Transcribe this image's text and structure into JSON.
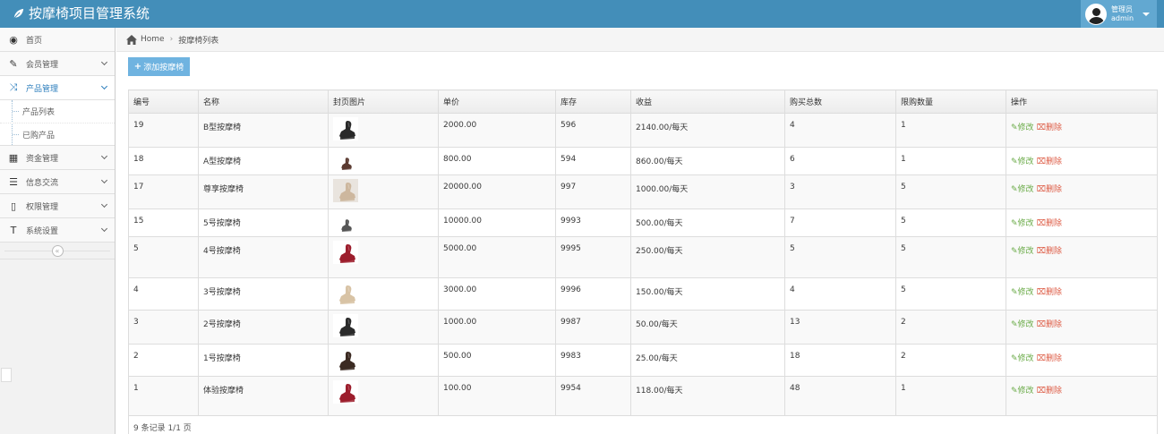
{
  "app": {
    "title": "按摩椅项目管理系统"
  },
  "user": {
    "role": "管理员",
    "name": "admin"
  },
  "sidebar": {
    "items": [
      {
        "label": "首页",
        "icon": "dashboard-icon",
        "glyph": "◉"
      },
      {
        "label": "会员管理",
        "icon": "edit-icon",
        "glyph": "✎"
      },
      {
        "label": "产品管理",
        "icon": "shuffle-icon",
        "glyph": "⤨",
        "open": true,
        "children": [
          {
            "label": "产品列表"
          },
          {
            "label": "已购产品"
          }
        ]
      },
      {
        "label": "资金管理",
        "icon": "calendar-icon",
        "glyph": "▦"
      },
      {
        "label": "信息交流",
        "icon": "list-icon",
        "glyph": "☰"
      },
      {
        "label": "权限管理",
        "icon": "file-icon",
        "glyph": "▯"
      },
      {
        "label": "系统设置",
        "icon": "text-icon",
        "glyph": "T"
      }
    ],
    "collapse_glyph": "«"
  },
  "breadcrumb": {
    "home": "Home",
    "current": "按摩椅列表"
  },
  "toolbar": {
    "add_label": "添加按摩椅"
  },
  "table": {
    "headers": [
      "编号",
      "名称",
      "封页图片",
      "单价",
      "库存",
      "收益",
      "购买总数",
      "限购数量",
      "操作"
    ],
    "edit_label": "修改",
    "delete_label": "删除",
    "rows": [
      {
        "id": "19",
        "name": "B型按摩椅",
        "img": "chair-black",
        "price": "2000.00",
        "stock": "596",
        "income": "2140.00/每天",
        "total": "4",
        "limit": "1"
      },
      {
        "id": "18",
        "name": "A型按摩椅",
        "img": "chair-small-brown",
        "price": "800.00",
        "stock": "594",
        "income": "860.00/每天",
        "total": "6",
        "limit": "1"
      },
      {
        "id": "17",
        "name": "尊享按摩椅",
        "img": "chair-beige-photo",
        "price": "20000.00",
        "stock": "997",
        "income": "1000.00/每天",
        "total": "3",
        "limit": "5"
      },
      {
        "id": "15",
        "name": "5号按摩椅",
        "img": "chair-small-grey",
        "price": "10000.00",
        "stock": "9993",
        "income": "500.00/每天",
        "total": "7",
        "limit": "5"
      },
      {
        "id": "5",
        "name": "4号按摩椅",
        "img": "chair-red",
        "price": "5000.00",
        "stock": "9995",
        "income": "250.00/每天",
        "total": "5",
        "limit": "5"
      },
      {
        "id": "4",
        "name": "3号按摩椅",
        "img": "chair-beige",
        "price": "3000.00",
        "stock": "9996",
        "income": "150.00/每天",
        "total": "4",
        "limit": "5"
      },
      {
        "id": "3",
        "name": "2号按摩椅",
        "img": "chair-black",
        "price": "1000.00",
        "stock": "9987",
        "income": "50.00/每天",
        "total": "13",
        "limit": "2"
      },
      {
        "id": "2",
        "name": "1号按摩椅",
        "img": "chair-dark-brown",
        "price": "500.00",
        "stock": "9983",
        "income": "25.00/每天",
        "total": "18",
        "limit": "2"
      },
      {
        "id": "1",
        "name": "体验按摩椅",
        "img": "chair-red",
        "price": "100.00",
        "stock": "9954",
        "income": "118.00/每天",
        "total": "48",
        "limit": "1"
      }
    ],
    "footer": "9 条记录 1/1 页"
  },
  "colors": {
    "navbar": "#438eb9",
    "user_box": "#62a8d1",
    "add_button": "#6fb3e0",
    "edit": "#69aa46",
    "delete": "#dd5a43",
    "active_menu": "#2b7dbc"
  }
}
